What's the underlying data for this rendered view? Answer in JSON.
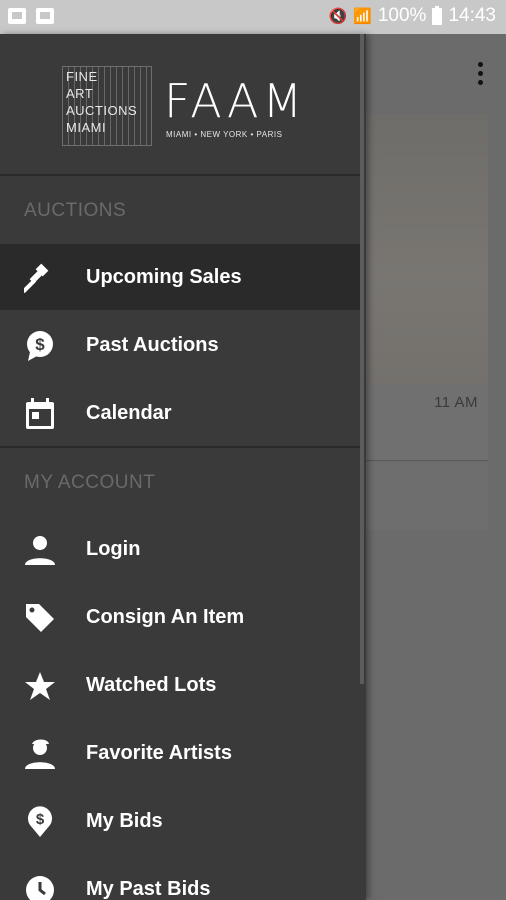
{
  "status_bar": {
    "battery": "100%",
    "time": "14:43"
  },
  "background": {
    "time_label": "11 AM"
  },
  "brand": {
    "logo_words": [
      "FINE",
      "ART",
      "AUCTIONS",
      "MIAMI"
    ],
    "name": "FAAM",
    "cities": "MIAMI  •  NEW YORK  •  PARIS"
  },
  "drawer": {
    "section_auctions": "AUCTIONS",
    "section_account": "MY ACCOUNT",
    "items": [
      {
        "label": "Upcoming Sales",
        "icon": "gavel-icon"
      },
      {
        "label": "Past Auctions",
        "icon": "dollar-bubble-icon"
      },
      {
        "label": "Calendar",
        "icon": "calendar-icon"
      },
      {
        "label": "Login",
        "icon": "person-icon"
      },
      {
        "label": "Consign An Item",
        "icon": "tag-icon"
      },
      {
        "label": "Watched Lots",
        "icon": "star-icon"
      },
      {
        "label": "Favorite Artists",
        "icon": "artist-icon"
      },
      {
        "label": "My Bids",
        "icon": "bid-pin-icon"
      },
      {
        "label": "My Past Bids",
        "icon": "clock-icon"
      }
    ]
  },
  "colors": {
    "drawer_bg": "#3a3a3a",
    "active_bg": "#2a2a2a",
    "section_text": "#6a6a6a"
  }
}
